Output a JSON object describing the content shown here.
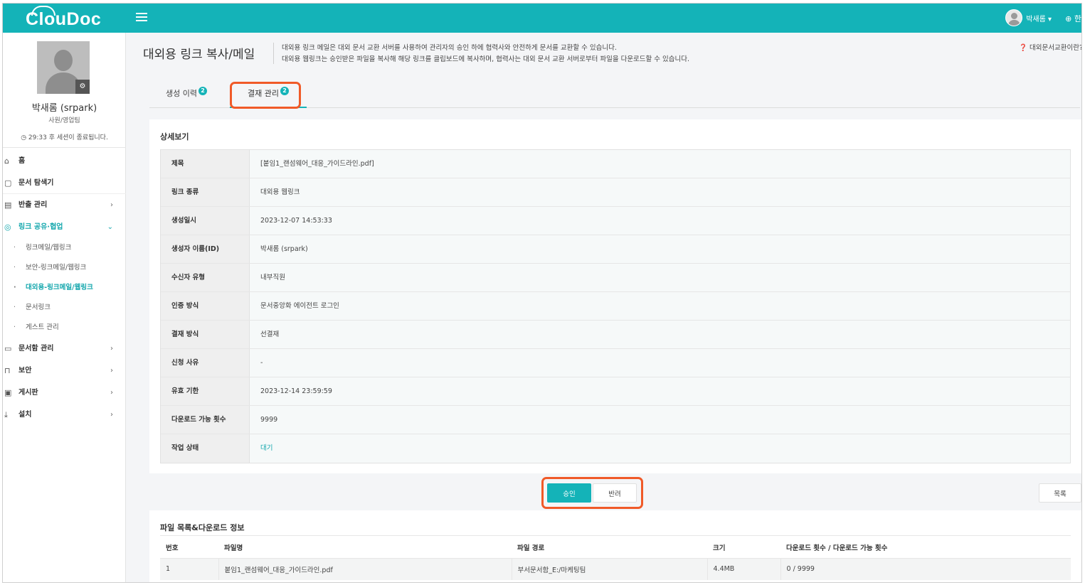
{
  "app": {
    "logo": "ClouDoc"
  },
  "topbar": {
    "user_name": "박새롬 ▾",
    "globe": "⊕ 한"
  },
  "profile": {
    "name": "박새롬 (srpark)",
    "dept": "사원/영업팀",
    "session": "29:33 후 세션이 종료됩니다."
  },
  "sidebar": {
    "items": [
      {
        "icon": "⌂",
        "label": "홈"
      },
      {
        "icon": "▢",
        "label": "문서 탐색기"
      },
      {
        "icon": "▤",
        "label": "반출 관리",
        "chev": "›"
      },
      {
        "icon": "◎",
        "label": "링크 공유·협업",
        "chev": "⌄"
      },
      {
        "icon": "▭",
        "label": "문서함 관리",
        "chev": "›"
      },
      {
        "icon": "⊓",
        "label": "보안",
        "chev": "›"
      },
      {
        "icon": "▣",
        "label": "게시판",
        "chev": "›"
      },
      {
        "icon": "⤓",
        "label": "설치",
        "chev": "›"
      }
    ],
    "sub_items": [
      {
        "label": "링크메일/웹링크"
      },
      {
        "label": "보안-링크메일/웹링크"
      },
      {
        "label": "대외용-링크메일/웹링크"
      },
      {
        "label": "문서링크"
      },
      {
        "label": "게스트 관리"
      }
    ]
  },
  "header": {
    "title": "대외용 링크 복사/메일",
    "desc1": "대외용 링크 메일은 대외 문서 교환 서버를 사용하여 관리자의 승인 하에 협력사와 안전하게 문서를 교환할 수 있습니다.",
    "desc2": "대외용 웹링크는 승인받은 파일을 복사해 해당 링크를 클립보드에 복사하며, 협력사는 대외 문서 교환 서버로부터 파일을 다운로드할 수 있습니다.",
    "help": "❓ 대외문서교환이란?"
  },
  "tabs": [
    {
      "label": "생성 이력",
      "badge": "2"
    },
    {
      "label": "결재 관리",
      "badge": "2"
    }
  ],
  "detail": {
    "title": "상세보기",
    "rows": [
      {
        "label": "제목",
        "value": "[붙임1_랜섬웨어_대응_가이드라인.pdf]"
      },
      {
        "label": "링크 종류",
        "value": "대외용 웹링크"
      },
      {
        "label": "생성일시",
        "value": "2023-12-07 14:53:33"
      },
      {
        "label": "생성자 이름(ID)",
        "value": "박새롬 (srpark)"
      },
      {
        "label": "수신자 유형",
        "value": "내부직원"
      },
      {
        "label": "인증 방식",
        "value": "문서중앙화 에이전트 로그인"
      },
      {
        "label": "결재 방식",
        "value": "선결재"
      },
      {
        "label": "신청 사유",
        "value": "-"
      },
      {
        "label": "유효 기한",
        "value": "2023-12-14 23:59:59"
      },
      {
        "label": "다운로드 가능 횟수",
        "value": "9999"
      },
      {
        "label": "작업 상태",
        "value": "대기"
      }
    ]
  },
  "buttons": {
    "approve": "승인",
    "reject": "반려",
    "list": "목록"
  },
  "files": {
    "title": "파일 목록&다운로드 정보",
    "columns": [
      "번호",
      "파일명",
      "파일 경로",
      "크기",
      "다운로드 횟수 / 다운로드 가능 횟수"
    ],
    "rows": [
      [
        "1",
        "붙임1_랜섬웨어_대응_가이드라인.pdf",
        "부서문서함_E:/마케팅팀",
        "4.4MB",
        "0 / 9999"
      ]
    ]
  },
  "colors": {
    "accent": "#14b3b8",
    "highlight": "#f05a28"
  }
}
